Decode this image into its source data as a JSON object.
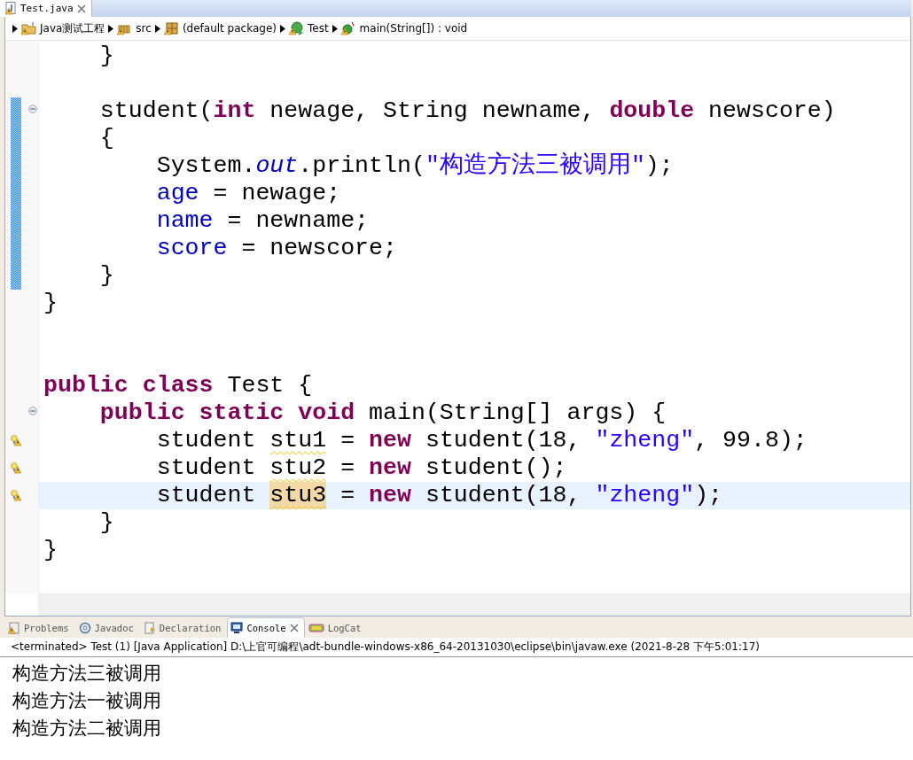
{
  "editor_tab": {
    "label": "Test.java",
    "selected": true
  },
  "breadcrumb": [
    {
      "kind": "project",
      "label": "Java测试工程"
    },
    {
      "kind": "folder",
      "label": "src"
    },
    {
      "kind": "package",
      "label": "(default package)"
    },
    {
      "kind": "class",
      "label": "Test"
    },
    {
      "kind": "method",
      "label": "main(String[]) : void"
    }
  ],
  "code_lines": [
    {
      "changed": false,
      "folding": false,
      "warning": false,
      "current": false,
      "tokens": [
        {
          "kind": "plain",
          "text": "    }"
        }
      ]
    },
    {
      "changed": false,
      "folding": false,
      "warning": false,
      "current": false
    },
    {
      "changed": true,
      "folding": true,
      "warning": false,
      "current": false,
      "tokens": [
        {
          "kind": "plain",
          "text": "    student("
        },
        {
          "kind": "keyword",
          "text": "int"
        },
        {
          "kind": "plain",
          "text": " newage, String newname, "
        },
        {
          "kind": "keyword",
          "text": "double"
        },
        {
          "kind": "plain",
          "text": " newscore)"
        }
      ]
    },
    {
      "changed": true,
      "folding": false,
      "warning": false,
      "current": false,
      "tokens": [
        {
          "kind": "plain",
          "text": "    {"
        }
      ]
    },
    {
      "changed": true,
      "folding": false,
      "warning": false,
      "current": false,
      "tokens": [
        {
          "kind": "plain",
          "text": "        System."
        },
        {
          "kind": "static",
          "text": "out"
        },
        {
          "kind": "plain",
          "text": ".println("
        },
        {
          "kind": "string",
          "text": "\"构造方法三被调用\""
        },
        {
          "kind": "plain",
          "text": ");"
        }
      ]
    },
    {
      "changed": true,
      "folding": false,
      "warning": false,
      "current": false,
      "tokens": [
        {
          "kind": "field",
          "text": "        age"
        },
        {
          "kind": "plain",
          "text": " = newage;"
        }
      ]
    },
    {
      "changed": true,
      "folding": false,
      "warning": false,
      "current": false,
      "tokens": [
        {
          "kind": "field",
          "text": "        name"
        },
        {
          "kind": "plain",
          "text": " = newname;"
        }
      ]
    },
    {
      "changed": true,
      "folding": false,
      "warning": false,
      "current": false,
      "tokens": [
        {
          "kind": "field",
          "text": "        score"
        },
        {
          "kind": "plain",
          "text": " = newscore;"
        }
      ]
    },
    {
      "changed": true,
      "folding": false,
      "warning": false,
      "current": false,
      "tokens": [
        {
          "kind": "plain",
          "text": "    }"
        }
      ]
    },
    {
      "changed": false,
      "folding": false,
      "warning": false,
      "current": false,
      "tokens": [
        {
          "kind": "plain",
          "text": "}"
        }
      ]
    },
    {
      "changed": false,
      "folding": false,
      "warning": false,
      "current": false
    },
    {
      "changed": false,
      "folding": false,
      "warning": false,
      "current": false
    },
    {
      "changed": false,
      "folding": false,
      "warning": false,
      "current": false,
      "tokens": [
        {
          "kind": "keyword",
          "text": "public class"
        },
        {
          "kind": "plain",
          "text": " Test {"
        }
      ]
    },
    {
      "changed": false,
      "folding": true,
      "warning": false,
      "current": false,
      "tokens": [
        {
          "kind": "keyword",
          "text": "    public static void"
        },
        {
          "kind": "plain",
          "text": " main(String[] args) {"
        }
      ]
    },
    {
      "changed": false,
      "folding": false,
      "warning": true,
      "current": false,
      "tokens": [
        {
          "kind": "plain",
          "text": "        student "
        },
        {
          "kind": "unused",
          "text": "stu1"
        },
        {
          "kind": "plain",
          "text": " = "
        },
        {
          "kind": "keyword",
          "text": "new"
        },
        {
          "kind": "plain",
          "text": " student(18, "
        },
        {
          "kind": "string",
          "text": "\"zheng\""
        },
        {
          "kind": "plain",
          "text": ", 99.8);"
        }
      ]
    },
    {
      "changed": false,
      "folding": false,
      "warning": true,
      "current": false,
      "tokens": [
        {
          "kind": "plain",
          "text": "        student "
        },
        {
          "kind": "unused",
          "text": "stu2"
        },
        {
          "kind": "plain",
          "text": " = "
        },
        {
          "kind": "keyword",
          "text": "new"
        },
        {
          "kind": "plain",
          "text": " student();"
        }
      ]
    },
    {
      "changed": false,
      "folding": false,
      "warning": true,
      "current": true,
      "tokens": [
        {
          "kind": "plain",
          "text": "        student "
        },
        {
          "kind": "occurrence",
          "text": "stu3"
        },
        {
          "kind": "plain",
          "text": " = "
        },
        {
          "kind": "keyword",
          "text": "new"
        },
        {
          "kind": "plain",
          "text": " student(18, "
        },
        {
          "kind": "string",
          "text": "\"zheng\""
        },
        {
          "kind": "plain",
          "text": ");"
        }
      ]
    },
    {
      "changed": false,
      "folding": false,
      "warning": false,
      "current": false,
      "tokens": [
        {
          "kind": "plain",
          "text": "    }"
        }
      ]
    },
    {
      "changed": false,
      "folding": false,
      "warning": false,
      "current": false,
      "tokens": [
        {
          "kind": "plain",
          "text": "}"
        }
      ]
    }
  ],
  "view_tabs": [
    {
      "kind": "problems",
      "label": "Problems",
      "selected": false
    },
    {
      "kind": "javadoc",
      "label": "Javadoc",
      "selected": false
    },
    {
      "kind": "declaration",
      "label": "Declaration",
      "selected": false
    },
    {
      "kind": "console",
      "label": "Console",
      "selected": true
    },
    {
      "kind": "logcat",
      "label": "LogCat",
      "selected": false
    }
  ],
  "console": {
    "header": "<terminated> Test (1) [Java Application] D:\\上官可编程\\adt-bundle-windows-x86_64-20131030\\eclipse\\bin\\javaw.exe (2021-8-28 下午5:01:17)",
    "output": [
      "构造方法三被调用",
      "构造方法一被调用",
      "构造方法二被调用"
    ]
  }
}
